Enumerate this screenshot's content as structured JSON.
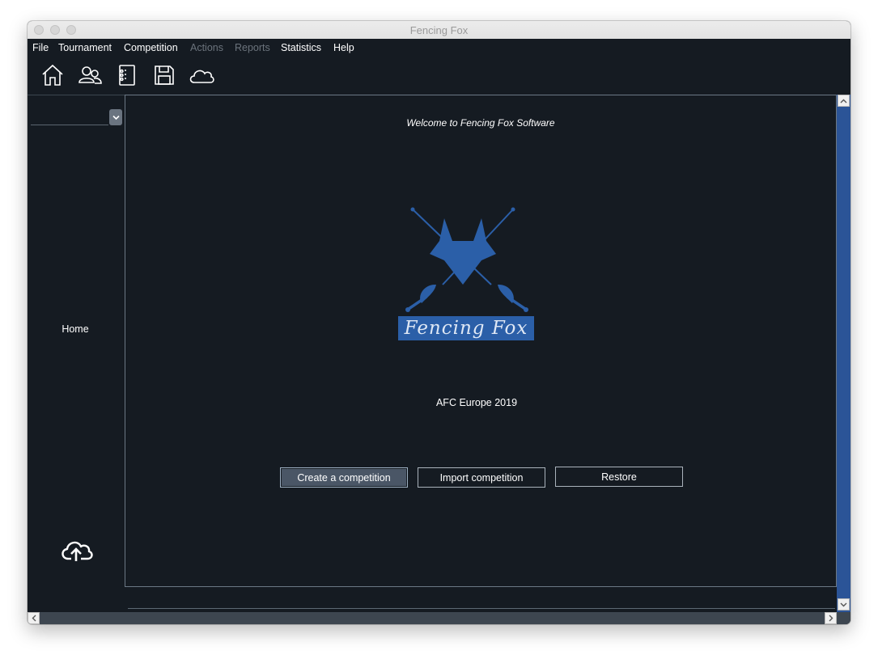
{
  "window": {
    "title": "Fencing Fox"
  },
  "menubar": {
    "items": [
      {
        "label": "File",
        "enabled": true
      },
      {
        "label": "Tournament",
        "enabled": true
      },
      {
        "label": "Competition",
        "enabled": true
      },
      {
        "label": "Actions",
        "enabled": false
      },
      {
        "label": "Reports",
        "enabled": false
      },
      {
        "label": "Statistics",
        "enabled": true
      },
      {
        "label": "Help",
        "enabled": true
      }
    ]
  },
  "toolbar": {
    "icons": [
      "home-icon",
      "users-icon",
      "notebook-icon",
      "floppy-disk-icon",
      "cloud-icon"
    ]
  },
  "sidebar": {
    "selector_value": "",
    "home_label": "Home",
    "upload_icon": "cloud-upload-icon"
  },
  "main": {
    "welcome_text": "Welcome to Fencing Fox Software",
    "logo_text": "Fencing Fox",
    "competition_name": "AFC Europe 2019",
    "buttons": {
      "create": "Create a competition",
      "import": "Import competition",
      "restore": "Restore"
    }
  },
  "colors": {
    "background": "#151b22",
    "accent": "#2b5fa8",
    "scrollbar": "#2b5497",
    "text": "#ffffff"
  }
}
